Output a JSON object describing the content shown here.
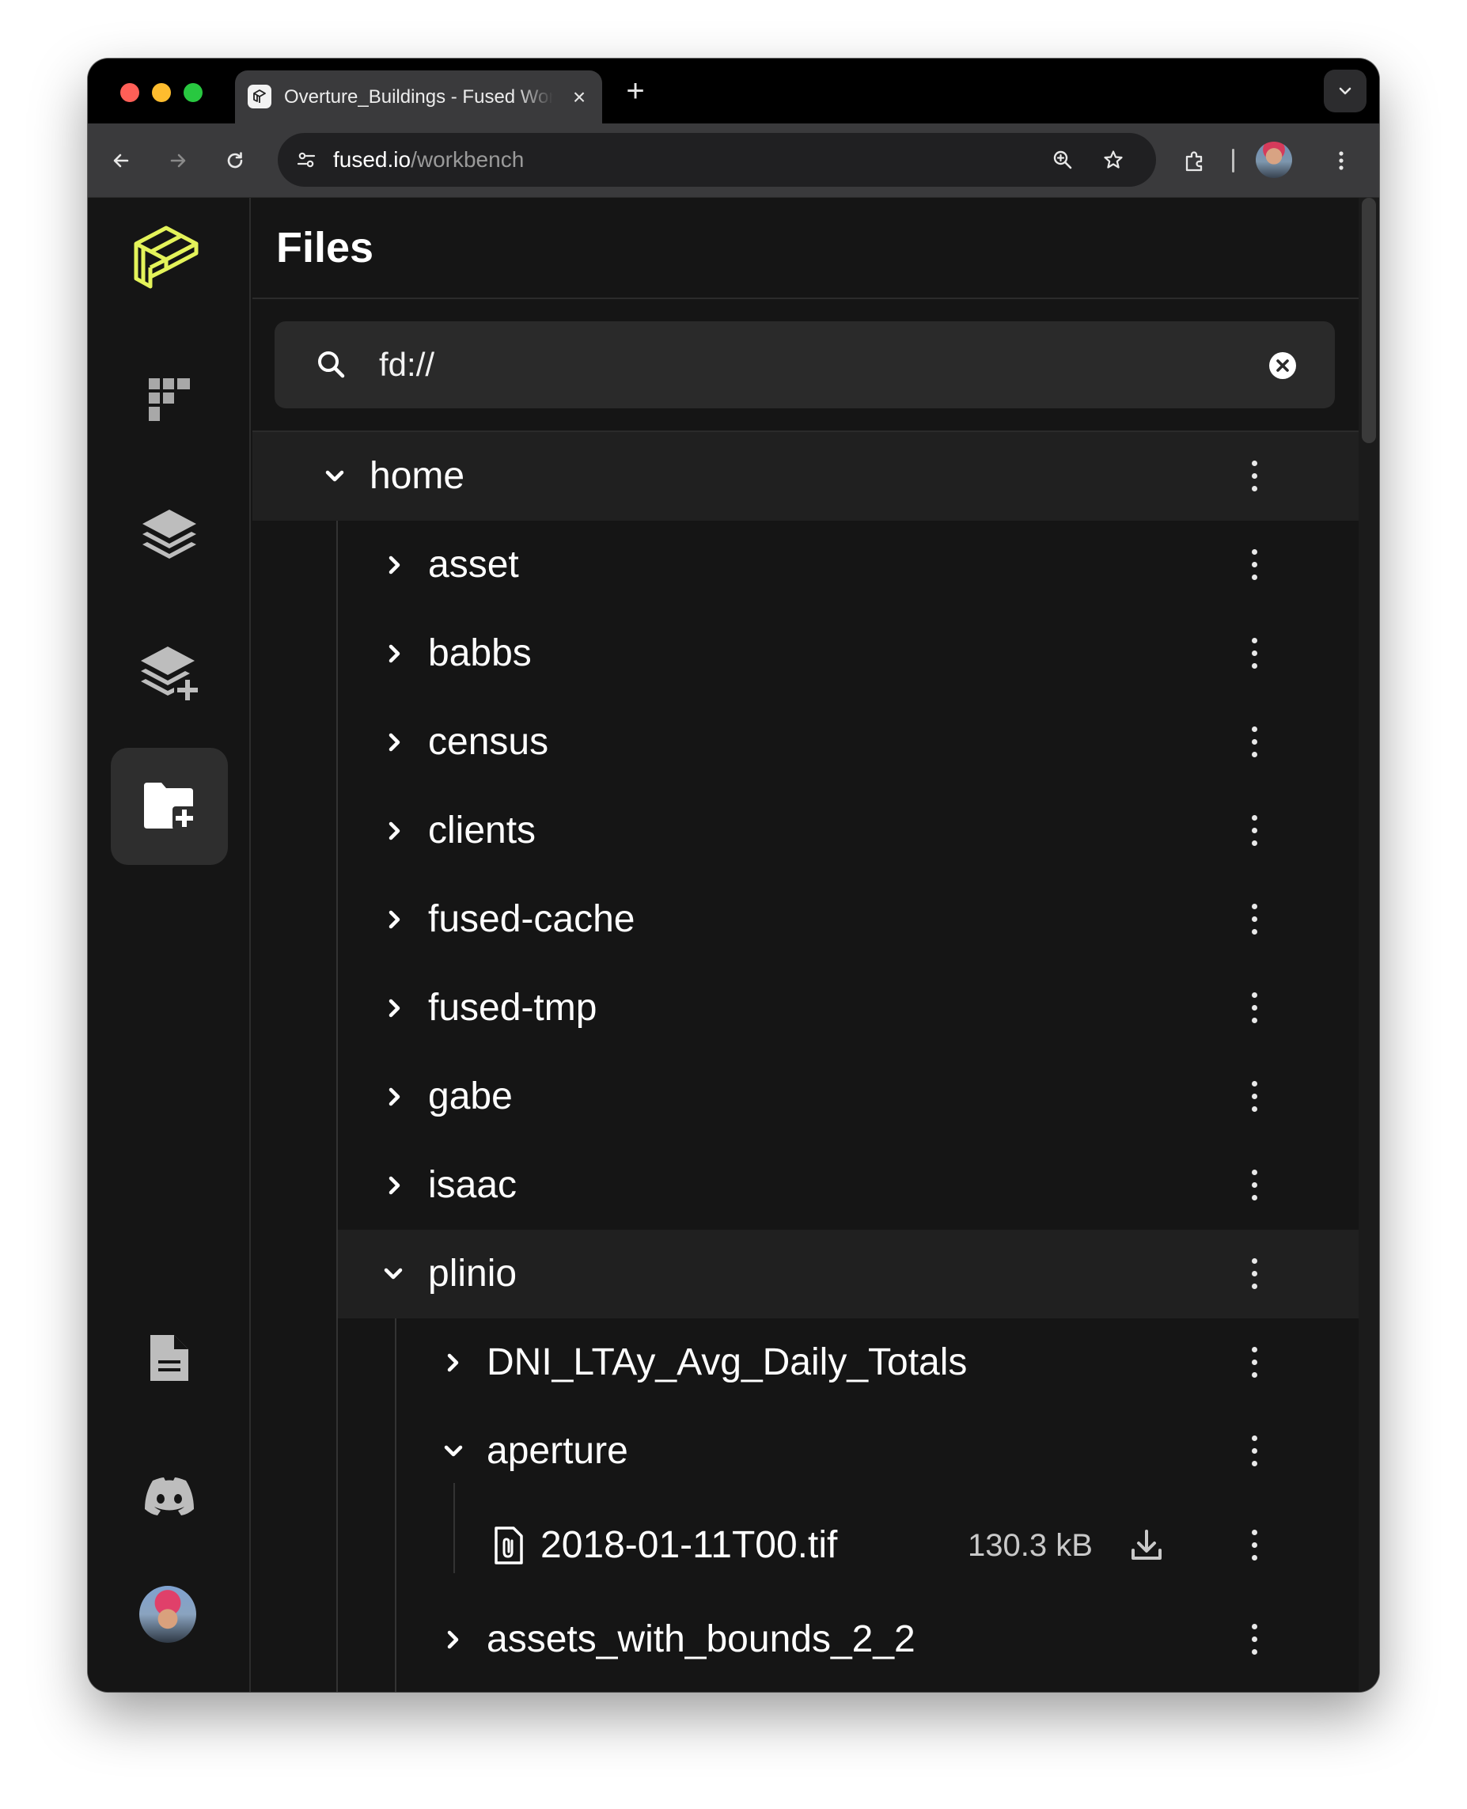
{
  "browser": {
    "tab_title": "Overture_Buildings - Fused Workbench",
    "url_host": "fused.io",
    "url_path": "/workbench"
  },
  "panel": {
    "title": "Files",
    "search_value": "fd://"
  },
  "colors": {
    "accent": "#e4f35a",
    "background": "#151515",
    "rail_active": "#2e2e2e",
    "row_highlight": "#202020"
  },
  "sidebar": {
    "items": [
      {
        "name": "fused-logo",
        "active": false
      },
      {
        "name": "udf-catalog-icon",
        "active": false
      },
      {
        "name": "layers-icon",
        "active": false
      },
      {
        "name": "add-layer-icon",
        "active": false
      },
      {
        "name": "file-explorer-icon",
        "active": true
      },
      {
        "name": "docs-icon",
        "active": false
      },
      {
        "name": "discord-icon",
        "active": false
      },
      {
        "name": "user-avatar",
        "active": false
      }
    ]
  },
  "tree": {
    "root": {
      "label": "home",
      "expanded": true
    },
    "home_children": [
      {
        "label": "asset",
        "expanded": false
      },
      {
        "label": "babbs",
        "expanded": false
      },
      {
        "label": "census",
        "expanded": false
      },
      {
        "label": "clients",
        "expanded": false
      },
      {
        "label": "fused-cache",
        "expanded": false
      },
      {
        "label": "fused-tmp",
        "expanded": false
      },
      {
        "label": "gabe",
        "expanded": false
      },
      {
        "label": "isaac",
        "expanded": false
      },
      {
        "label": "plinio",
        "expanded": true
      }
    ],
    "plinio_children": [
      {
        "label": "DNI_LTAy_Avg_Daily_Totals",
        "expanded": false
      },
      {
        "label": "aperture",
        "expanded": true
      },
      {
        "label": "assets_with_bounds_2_2",
        "expanded": false
      }
    ],
    "aperture_files": [
      {
        "name": "2018-01-11T00.tif",
        "size": "130.3 kB"
      }
    ]
  }
}
